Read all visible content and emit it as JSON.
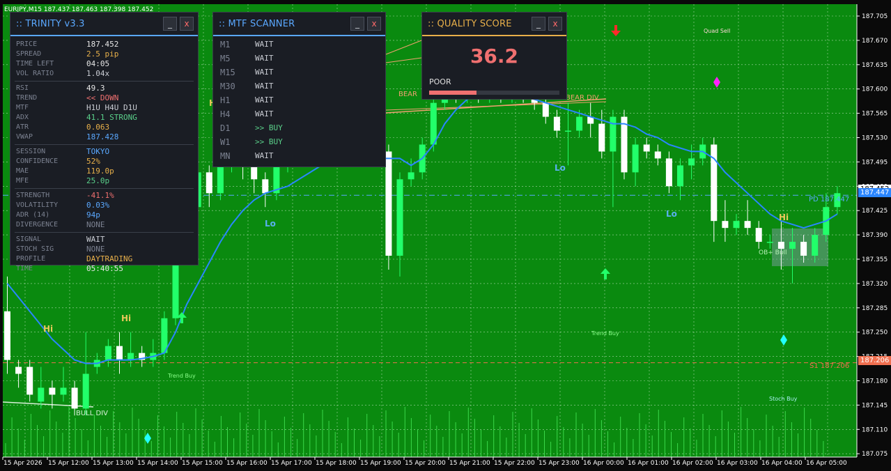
{
  "window": {
    "symbol_line": "EURJPY,M15  187.437 187.463 187.398 187.452"
  },
  "colors": {
    "background": "#0a8a0f",
    "grid": "#a8d8a8",
    "bull_candle": "#22ff6a",
    "bear_candle": "#ffffff",
    "ma_line": "#2a86ff",
    "sell_arrow": "#ff2a2a",
    "buy_arrow": "#22ff6a",
    "diamond_magenta": "#ff22ff",
    "diamond_cyan": "#22ffff"
  },
  "axis": {
    "price_labels": [
      "187.705",
      "187.670",
      "187.635",
      "187.600",
      "187.565",
      "187.530",
      "187.495",
      "187.460",
      "187.425",
      "187.390",
      "187.355",
      "187.320",
      "187.285",
      "187.250",
      "187.215",
      "187.180",
      "187.145",
      "187.110",
      "187.075"
    ],
    "time_labels": [
      "15 Apr 2026",
      "15 Apr 12:00",
      "15 Apr 13:00",
      "15 Apr 14:00",
      "15 Apr 15:00",
      "15 Apr 16:00",
      "15 Apr 17:00",
      "15 Apr 18:00",
      "15 Apr 19:00",
      "15 Apr 20:00",
      "15 Apr 21:00",
      "15 Apr 22:00",
      "15 Apr 23:00",
      "16 Apr 00:00",
      "16 Apr 01:00",
      "16 Apr 02:00",
      "16 Apr 03:00",
      "16 Apr 04:00",
      "16 Apr 05:00"
    ],
    "current_price_tag": "187.447",
    "current_price_tag2": "187.452",
    "s1_tag": "187.206"
  },
  "chart_data": {
    "type": "candlestick",
    "price_axis_range": [
      187.07,
      187.72
    ],
    "candles": [
      [
        187.28,
        187.21,
        187.33,
        187.19
      ],
      [
        187.2,
        187.19,
        187.21,
        187.17
      ],
      [
        187.2,
        187.16,
        187.21,
        187.15
      ],
      [
        187.15,
        187.17,
        187.2,
        187.14
      ],
      [
        187.17,
        187.16,
        187.18,
        187.14
      ],
      [
        187.16,
        187.17,
        187.2,
        187.15
      ],
      [
        187.17,
        187.14,
        187.18,
        187.13
      ],
      [
        187.14,
        187.19,
        187.25,
        187.13
      ],
      [
        187.2,
        187.21,
        187.22,
        187.19
      ],
      [
        187.21,
        187.23,
        187.24,
        187.2
      ],
      [
        187.23,
        187.21,
        187.25,
        187.19
      ],
      [
        187.21,
        187.22,
        187.25,
        187.2
      ],
      [
        187.22,
        187.21,
        187.23,
        187.2
      ],
      [
        187.21,
        187.22,
        187.24,
        187.2
      ],
      [
        187.22,
        187.27,
        187.28,
        187.21
      ],
      [
        187.27,
        187.38,
        187.4,
        187.26
      ],
      [
        187.38,
        187.43,
        187.45,
        187.37
      ],
      [
        187.43,
        187.48,
        187.5,
        187.42
      ],
      [
        187.48,
        187.45,
        187.49,
        187.43
      ],
      [
        187.45,
        187.49,
        187.51,
        187.44
      ],
      [
        187.49,
        187.52,
        187.53,
        187.48
      ],
      [
        187.52,
        187.5,
        187.53,
        187.47
      ],
      [
        187.5,
        187.47,
        187.51,
        187.45
      ],
      [
        187.47,
        187.45,
        187.48,
        187.43
      ],
      [
        187.45,
        187.49,
        187.51,
        187.44
      ],
      [
        187.49,
        187.52,
        187.53,
        187.48
      ],
      [
        187.52,
        187.5,
        187.53,
        187.49
      ],
      [
        187.5,
        187.53,
        187.55,
        187.49
      ],
      [
        187.53,
        187.51,
        187.54,
        187.5
      ],
      [
        187.51,
        187.52,
        187.53,
        187.5
      ],
      [
        187.52,
        187.5,
        187.53,
        187.49
      ],
      [
        187.5,
        187.51,
        187.52,
        187.49
      ],
      [
        187.51,
        187.5,
        187.52,
        187.49
      ],
      [
        187.5,
        187.51,
        187.52,
        187.49
      ],
      [
        187.51,
        187.36,
        187.52,
        187.34
      ],
      [
        187.36,
        187.47,
        187.48,
        187.33
      ],
      [
        187.47,
        187.48,
        187.5,
        187.46
      ],
      [
        187.48,
        187.52,
        187.53,
        187.47
      ],
      [
        187.52,
        187.58,
        187.6,
        187.51
      ],
      [
        187.58,
        187.6,
        187.61,
        187.57
      ],
      [
        187.6,
        187.59,
        187.62,
        187.58
      ],
      [
        187.59,
        187.6,
        187.61,
        187.58
      ],
      [
        187.6,
        187.59,
        187.61,
        187.58
      ],
      [
        187.59,
        187.6,
        187.62,
        187.58
      ],
      [
        187.6,
        187.59,
        187.61,
        187.58
      ],
      [
        187.59,
        187.6,
        187.61,
        187.58
      ],
      [
        187.6,
        187.59,
        187.61,
        187.58
      ],
      [
        187.59,
        187.58,
        187.6,
        187.57
      ],
      [
        187.58,
        187.56,
        187.59,
        187.55
      ],
      [
        187.56,
        187.54,
        187.57,
        187.53
      ],
      [
        187.54,
        187.54,
        187.58,
        187.49
      ],
      [
        187.54,
        187.56,
        187.57,
        187.53
      ],
      [
        187.56,
        187.55,
        187.58,
        187.53
      ],
      [
        187.55,
        187.51,
        187.57,
        187.5
      ],
      [
        187.51,
        187.56,
        187.57,
        187.43
      ],
      [
        187.56,
        187.48,
        187.57,
        187.47
      ],
      [
        187.48,
        187.52,
        187.53,
        187.46
      ],
      [
        187.52,
        187.51,
        187.53,
        187.5
      ],
      [
        187.51,
        187.5,
        187.52,
        187.49
      ],
      [
        187.5,
        187.46,
        187.51,
        187.45
      ],
      [
        187.46,
        187.49,
        187.5,
        187.44
      ],
      [
        187.49,
        187.5,
        187.52,
        187.47
      ],
      [
        187.5,
        187.52,
        187.53,
        187.49
      ],
      [
        187.52,
        187.41,
        187.53,
        187.38
      ],
      [
        187.41,
        187.4,
        187.44,
        187.38
      ],
      [
        187.4,
        187.41,
        187.42,
        187.39
      ],
      [
        187.41,
        187.4,
        187.44,
        187.39
      ],
      [
        187.4,
        187.38,
        187.41,
        187.37
      ],
      [
        187.38,
        187.38,
        187.39,
        187.37
      ],
      [
        187.38,
        187.37,
        187.41,
        187.34
      ],
      [
        187.37,
        187.38,
        187.4,
        187.32
      ],
      [
        187.38,
        187.36,
        187.39,
        187.35
      ],
      [
        187.36,
        187.39,
        187.4,
        187.35
      ],
      [
        187.39,
        187.43,
        187.45,
        187.38
      ],
      [
        187.43,
        187.45,
        187.46,
        187.42
      ]
    ],
    "ma": [
      187.32,
      187.3,
      187.28,
      187.26,
      187.24,
      187.225,
      187.21,
      187.205,
      187.205,
      187.21,
      187.21,
      187.21,
      187.212,
      187.215,
      187.22,
      187.25,
      187.29,
      187.32,
      187.35,
      187.38,
      187.405,
      187.425,
      187.44,
      187.45,
      187.455,
      187.46,
      187.47,
      187.48,
      187.49,
      187.49,
      187.495,
      187.5,
      187.5,
      187.5,
      187.5,
      187.5,
      187.49,
      187.5,
      187.52,
      187.55,
      187.57,
      187.585,
      187.59,
      187.595,
      187.595,
      187.595,
      187.59,
      187.585,
      187.58,
      187.575,
      187.57,
      187.565,
      187.56,
      187.555,
      187.55,
      187.55,
      187.545,
      187.535,
      187.53,
      187.52,
      187.515,
      187.51,
      187.51,
      187.5,
      187.48,
      187.465,
      187.45,
      187.435,
      187.42,
      187.41,
      187.405,
      187.4,
      187.405,
      187.41,
      187.42
    ]
  },
  "labels": {
    "hi1": "Hi",
    "hi2": "Hi",
    "hi3": "Hi",
    "lo1": "Lo",
    "lo2": "Lo",
    "lo3": "Lo",
    "trend_buy1": "Trend Buy",
    "trend_buy2": "Trend Buy",
    "bull_div": "BULL DIV",
    "bear_div": "BEAR DIV",
    "bear": "BEAR",
    "quad_sell": "Quad Sell",
    "ob_bull": "OB+ Bull",
    "stoch_buy": "Stoch Buy",
    "s1": "S1 187.206",
    "pd": "PD 187.447",
    "h_letter": "H"
  },
  "trinity": {
    "title": ":: TRINITY v3.3",
    "min": "_",
    "close": "x",
    "groups": [
      [
        {
          "label": "PRICE",
          "value": "187.452",
          "color": "#e6e6e6"
        },
        {
          "label": "SPREAD",
          "value": "2.5 pip",
          "color": "#e8b04a"
        },
        {
          "label": "TIME LEFT",
          "value": "04:05",
          "color": "#e6e6e6"
        },
        {
          "label": "VOL RATIO",
          "value": "1.04x",
          "color": "#c9ccd3"
        }
      ],
      [
        {
          "label": "RSI",
          "value": "49.3",
          "color": "#e6e6e6"
        },
        {
          "label": "TREND",
          "value": "<< DOWN",
          "color": "#f07070"
        },
        {
          "label": "MTF",
          "value": "H1U H4U D1U",
          "color": "#c9ccd3"
        },
        {
          "label": "ADX",
          "value": "41.1 STRONG",
          "color": "#5ad08a"
        },
        {
          "label": "ATR",
          "value": "0.063",
          "color": "#e8b04a"
        },
        {
          "label": "VWAP",
          "value": "187.428",
          "color": "#5aa8ff"
        }
      ],
      [
        {
          "label": "SESSION",
          "value": "TOKYO",
          "color": "#5aa8ff"
        },
        {
          "label": "CONFIDENCE",
          "value": "52%",
          "color": "#e8b04a"
        },
        {
          "label": "MAE",
          "value": "119.0p",
          "color": "#e8b04a"
        },
        {
          "label": "MFE",
          "value": "25.0p",
          "color": "#5ad08a"
        }
      ],
      [
        {
          "label": "STRENGTH",
          "value": "-41.1%",
          "color": "#f07070"
        },
        {
          "label": "VOLATILITY",
          "value": "0.03%",
          "color": "#5aa8ff"
        },
        {
          "label": "ADR (14)",
          "value": "94p",
          "color": "#5aa8ff"
        },
        {
          "label": "DIVERGENCE",
          "value": "NONE",
          "color": "#7c8291"
        }
      ],
      [
        {
          "label": "SIGNAL",
          "value": "WAIT",
          "color": "#c9ccd3"
        },
        {
          "label": "STOCH SIG",
          "value": "NONE",
          "color": "#7c8291"
        },
        {
          "label": "PROFILE",
          "value": "DAYTRADING",
          "color": "#e8b04a"
        },
        {
          "label": "TIME",
          "value": "05:40:55",
          "color": "#e6e6e6"
        }
      ]
    ]
  },
  "mtf": {
    "title": ":: MTF SCANNER",
    "min": "_",
    "close": "x",
    "rows": [
      {
        "tf": "M1",
        "status": "WAIT",
        "color": "#c9ccd3"
      },
      {
        "tf": "M5",
        "status": "WAIT",
        "color": "#c9ccd3"
      },
      {
        "tf": "M15",
        "status": "WAIT",
        "color": "#c9ccd3"
      },
      {
        "tf": "M30",
        "status": "WAIT",
        "color": "#c9ccd3"
      },
      {
        "tf": "H1",
        "status": "WAIT",
        "color": "#c9ccd3"
      },
      {
        "tf": "H4",
        "status": "WAIT",
        "color": "#c9ccd3"
      },
      {
        "tf": "D1",
        "status": ">> BUY",
        "color": "#5ad08a"
      },
      {
        "tf": "W1",
        "status": ">> BUY",
        "color": "#5ad08a"
      },
      {
        "tf": "MN",
        "status": "WAIT",
        "color": "#c9ccd3"
      }
    ]
  },
  "quality": {
    "title": ":: QUALITY SCORE",
    "min": "_",
    "close": "x",
    "score": "36.2",
    "grade": "POOR",
    "fill_percent": 36.2
  }
}
